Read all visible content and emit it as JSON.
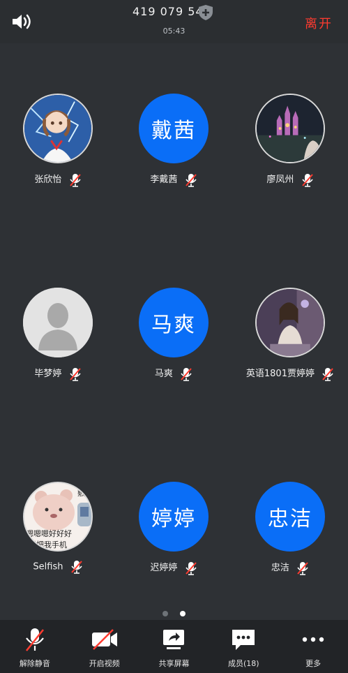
{
  "header": {
    "meeting_id": "419 079 544",
    "time": "05:43",
    "leave_label": "离开"
  },
  "participants": [
    {
      "name": "张欣怡",
      "avatar_type": "photo",
      "avatar_desc": "anime-girl-icon",
      "avatar_text": ""
    },
    {
      "name": "李戴茜",
      "avatar_type": "text",
      "avatar_text": "戴茜"
    },
    {
      "name": "廖凤州",
      "avatar_type": "photo",
      "avatar_desc": "castle-night-icon",
      "avatar_text": ""
    },
    {
      "name": "毕梦婷",
      "avatar_type": "photo",
      "avatar_desc": "default-user-icon",
      "avatar_text": ""
    },
    {
      "name": "马爽",
      "avatar_type": "text",
      "avatar_text": "马爽"
    },
    {
      "name": "英语1801贾婷婷",
      "avatar_type": "photo",
      "avatar_desc": "girl-photo-icon",
      "avatar_text": ""
    },
    {
      "name": "Selfish",
      "avatar_type": "photo",
      "avatar_desc": "bear-sticker-icon",
      "avatar_text": "",
      "avatar_caption_1": "嗯嗯嗯好好好",
      "avatar_caption_2": "样把我手机",
      "avatar_caption_3": "敷"
    },
    {
      "name": "迟婷婷",
      "avatar_type": "text",
      "avatar_text": "婷婷"
    },
    {
      "name": "忠洁",
      "avatar_type": "text",
      "avatar_text": "忠洁"
    }
  ],
  "pagination": {
    "active": 2,
    "total": 2
  },
  "toolbar": {
    "unmute_label": "解除静音",
    "video_label": "开启视频",
    "share_label": "共享屏幕",
    "members_label": "成员(18)",
    "more_label": "更多"
  },
  "colors": {
    "accent": "#0a6ef7",
    "leave": "#ff3b30",
    "muted_slash": "#ff3b30",
    "background": "#2e3135"
  }
}
